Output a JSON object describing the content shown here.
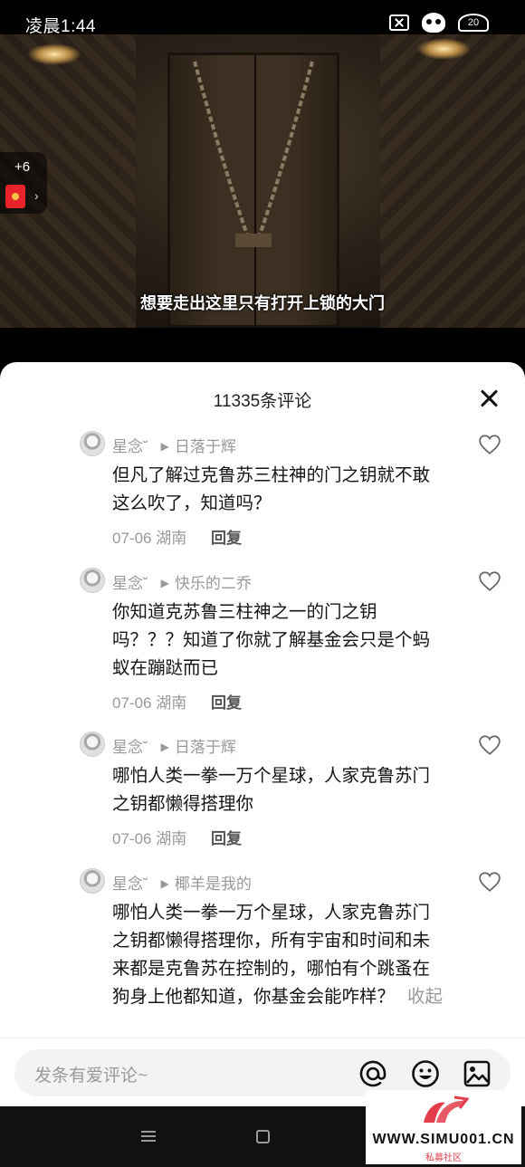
{
  "status_bar": {
    "time": "凌晨1:44",
    "battery": "20",
    "icons": [
      "close-box-icon",
      "skull-icon",
      "battery-icon"
    ]
  },
  "video": {
    "subtitle": "想要走出这里只有打开上锁的大门"
  },
  "side_badge": {
    "count": "+6",
    "icon": "red-envelope-icon"
  },
  "comments_panel": {
    "title": "11335条评论",
    "comments": [
      {
        "author": "星念˘",
        "reply_to": "日落于辉",
        "text": "但凡了解过克鲁苏三柱神的门之钥就不敢这么吹了，知道吗？",
        "date": "07-06",
        "location": "湖南",
        "reply_label": "回复"
      },
      {
        "author": "星念˘",
        "reply_to": "快乐的二乔",
        "text": "你知道克苏鲁三柱神之一的门之钥吗？？？知道了你就了解基金会只是个蚂蚁在蹦跶而已",
        "date": "07-06",
        "location": "湖南",
        "reply_label": "回复"
      },
      {
        "author": "星念˘",
        "reply_to": "日落于辉",
        "text": "哪怕人类一拳一万个星球，人家克鲁苏门之钥都懒得搭理你",
        "date": "07-06",
        "location": "湖南",
        "reply_label": "回复"
      },
      {
        "author": "星念˘",
        "reply_to": "椰羊是我的",
        "text": "哪怕人类一拳一万个星球，人家克鲁苏门之钥都懒得搭理你，所有宇宙和时间和未来都是克鲁苏在控制的，哪怕有个跳蚤在狗身上他都知道，你基金会能咋样？",
        "collapse_label": "收起"
      }
    ]
  },
  "input_bar": {
    "placeholder": "发条有爱评论~"
  },
  "watermark": {
    "site": "WWW.SIMU001.CN",
    "sub": "私募社区"
  },
  "colors": {
    "accent_red": "#e33d4b",
    "text_gray": "#999999"
  }
}
